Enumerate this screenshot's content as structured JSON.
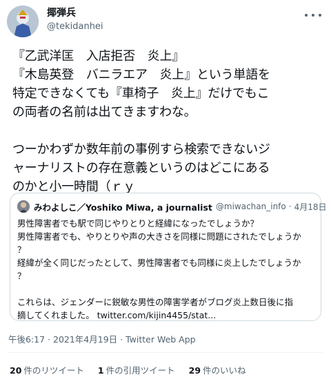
{
  "author": {
    "name": "揶弾兵",
    "handle": "@tekidanhei"
  },
  "tweet": {
    "lines": [
      "『乙武洋匡　入店拒否　炎上』",
      "『木島英登　バニラエア　炎上』という単語を",
      "特定できなくても『車椅子　炎上』だけでもこ",
      "の両者の名前は出てきますわな。",
      "",
      "つーかわずか数年前の事例すら検索できないジ",
      "ャーナリストの存在意義というのはどこにある",
      "のかと小一時間（ｒｙ"
    ]
  },
  "quote": {
    "name": "みわよしこ／Yoshiko Miwa, a journalist",
    "handle": "@miwachan_info",
    "separator": "·",
    "date": "4月18日",
    "lines": [
      "男性障害者でも駅で同じやりとりと経緯になったでしょうか？",
      "男性障害者でも、やりとりや声の大きさを同様に問題にされたでしょうか",
      "？",
      "経緯が全く同じだったとして、男性障害者でも同様に炎上したでしょうか",
      "？",
      "",
      "これらは、ジェンダーに鋭敏な男性の障害学者がブログ炎上数日後に指",
      "摘してくれました。 twitter.com/kijin4455/stat..."
    ]
  },
  "meta": {
    "time": "午後6:17",
    "separator1": " · ",
    "date": "2021年4月19日",
    "separator2": " · ",
    "client": "Twitter Web App"
  },
  "stats": {
    "retweets_count": "20",
    "retweets_label": "件のリツイート",
    "quotes_count": "1",
    "quotes_label": "件の引用ツイート",
    "likes_count": "29",
    "likes_label": "件のいいね"
  },
  "colors": {
    "text": "#0f1419",
    "secondary": "#536471",
    "border": "#cfd9de"
  }
}
